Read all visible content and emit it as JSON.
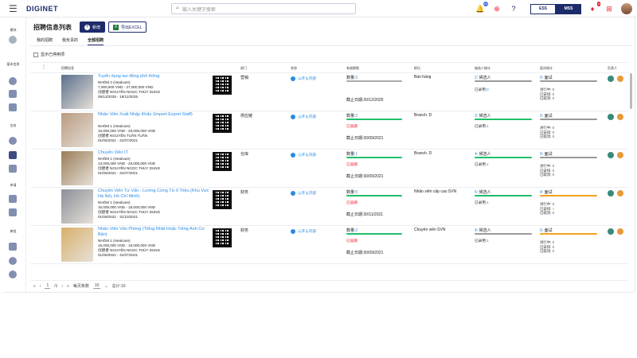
{
  "topbar": {
    "logo": "DIGINET",
    "search_placeholder": "输入关键字搜索",
    "notif_count": "10",
    "ess": "ESS",
    "mss": "MSS",
    "alert_count": "4"
  },
  "sidebar": {
    "sec1": "模块",
    "sec2": "基本信息",
    "sec3": "业务",
    "sec4": "申请",
    "sec5": "审批"
  },
  "page": {
    "title": "招聘信息列表",
    "new_label": "新增",
    "export_label": "导出EXCEL",
    "tabs": [
      "我的招聘",
      "我负责的",
      "全部招聘"
    ],
    "show_paused": "显示已停用项"
  },
  "columns": [
    "招聘信息",
    "部门",
    "状态",
    "有效期限",
    "职位",
    "候选人统计",
    "面试统计",
    "负责人"
  ],
  "rows": [
    {
      "title": "Tuyển dụng lao động phổ thông",
      "group": "NHÓM 3 (Healcare)",
      "salary": "7,000,000 VND - 27,000,000 VND",
      "creator": "创建者 NGUYỄN NGỌC THÙY DUNG",
      "dates": "06/12/2025 - 19/12/2025",
      "dept": "营销",
      "status": "公开＆内部",
      "qty": "3",
      "expired": "",
      "deadline": "20/12/2025",
      "position": "Bán hàng",
      "cand_n": "2",
      "cand_lbl": "候选人",
      "used": "0",
      "iv_n": "0",
      "iv_lbl": "面试",
      "iv_prog": "0",
      "iv_arr": "0",
      "iv_cancel": "0",
      "color": "#5b6f8c"
    },
    {
      "title": "Nhân Viên Xuất Nhập Khẩu (Import-Export Staff)",
      "group": "NHÓM 1 (Healcare)",
      "salary": "15,000,000 VND - 20,000,000 VND",
      "creator": "创建者 NGUYỄN TUẤN TUẤN",
      "dates": "01/05/2021 - 31/07/2021",
      "dept": "供应链",
      "status": "公开＆内部",
      "qty": "2",
      "expired": "已逾期",
      "deadline": "30/09/2021",
      "position": "Branch. D",
      "cand_n": "3",
      "cand_lbl": "候选人",
      "used": "1",
      "iv_n": "0",
      "iv_lbl": "面试",
      "iv_prog": "0",
      "iv_arr": "0",
      "iv_cancel": "0",
      "color": "#b99a80"
    },
    {
      "title": "Chuyên Viên IT",
      "group": "NHÓM 1 (Healcare)",
      "salary": "13,000,000 VND - 20,000,000 VND",
      "creator": "创建者 NGUYỄN NGỌC THÙY DUNG",
      "dates": "01/05/2021 - 31/07/2021",
      "dept": "仓库",
      "status": "公开＆内部",
      "qty": "1",
      "expired": "已逾期",
      "deadline": "30/09/2021",
      "position": "Branch. D",
      "cand_n": "4",
      "cand_lbl": "候选人",
      "used": "1",
      "iv_n": "0",
      "iv_lbl": "面试",
      "iv_prog": "0",
      "iv_arr": "0",
      "iv_cancel": "0",
      "color": "#9a7d58"
    },
    {
      "title": "Chuyên Viên Tư Vấn - Lương Cứng Từ 9 Triệu (Khu Vực Hà Nội, Hồ Chí Minh)",
      "group": "NHÓM 1 (Healcare)",
      "salary": "15,000,000 VND - 18,000,000 VND",
      "creator": "创建者 NGUYỄN NGỌC THÙY DUNG",
      "dates": "01/09/2021 - 31/10/2021",
      "dept": "财务",
      "status": "公开＆内部",
      "qty": "5",
      "expired": "已逾期",
      "deadline": "30/11/2021",
      "position": "Nhân viên cấp cao SVN",
      "cand_n": "5",
      "cand_lbl": "候选人",
      "used": "1",
      "iv_n": "4",
      "iv_lbl": "面试",
      "iv_prog": "0",
      "iv_arr": "4",
      "iv_cancel": "0",
      "color": "#8a8f99"
    },
    {
      "title": "Nhân Viên Văn Phòng (Tiếng Nhật Hoặc Tiếng Anh Cơ Bản)",
      "group": "NHÓM 1 (Healcare)",
      "salary": "15,000,000 VND - 18,000,000 VND",
      "creator": "创建者 NGUYỄN NGỌC THÙY DUNG",
      "dates": "01/05/2021 - 31/07/2021",
      "dept": "财务",
      "status": "公开＆内部",
      "qty": "2",
      "expired": "已逾期",
      "deadline": "30/09/2021",
      "position": "Chuyên viên SVN",
      "cand_n": "4",
      "cand_lbl": "候选人",
      "used": "1",
      "iv_n": "6",
      "iv_lbl": "面试",
      "iv_prog": "0",
      "iv_arr": "0",
      "iv_cancel": "0",
      "color": "#d9b06a"
    }
  ],
  "labels": {
    "qty": "数量:",
    "deadline": "截止日期:",
    "used": "已录用:",
    "prog": "进行中:",
    "arr": "已安排:",
    "cancel": "已取消:"
  },
  "footer": {
    "page": "1",
    "of": "/1",
    "per_page_lbl": "每页条数",
    "per_page": "10",
    "total": "总计:10"
  }
}
